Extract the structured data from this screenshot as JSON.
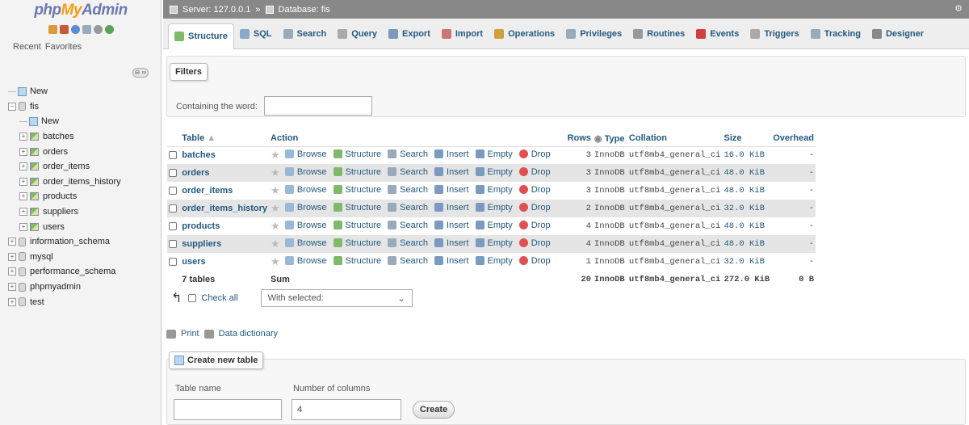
{
  "nav": {
    "logo_php": "php",
    "logo_my": "My",
    "logo_admin": "Admin",
    "tabs": [
      "Recent",
      "Favorites"
    ],
    "collapse_label": "⊖ ∞",
    "tree": [
      {
        "label": "New",
        "kind": "new",
        "indent": 0
      },
      {
        "label": "fis",
        "kind": "db",
        "indent": 0,
        "expanded": true
      },
      {
        "label": "New",
        "kind": "new",
        "indent": 1
      },
      {
        "label": "batches",
        "kind": "table",
        "indent": 1
      },
      {
        "label": "orders",
        "kind": "table",
        "indent": 1
      },
      {
        "label": "order_items",
        "kind": "table",
        "indent": 1
      },
      {
        "label": "order_items_history",
        "kind": "table",
        "indent": 1
      },
      {
        "label": "products",
        "kind": "table",
        "indent": 1
      },
      {
        "label": "suppliers",
        "kind": "table",
        "indent": 1
      },
      {
        "label": "users",
        "kind": "table",
        "indent": 1
      },
      {
        "label": "information_schema",
        "kind": "db",
        "indent": 0
      },
      {
        "label": "mysql",
        "kind": "db",
        "indent": 0
      },
      {
        "label": "performance_schema",
        "kind": "db",
        "indent": 0
      },
      {
        "label": "phpmyadmin",
        "kind": "db",
        "indent": 0
      },
      {
        "label": "test",
        "kind": "db",
        "indent": 0
      }
    ]
  },
  "topbar": {
    "server": "Server: 127.0.0.1",
    "sep": "»",
    "database": "Database: fis"
  },
  "tabs": [
    {
      "label": "Structure",
      "icon": "structure-icon",
      "color": "#7fb96a",
      "active": true
    },
    {
      "label": "SQL",
      "icon": "sql-icon",
      "color": "#8aa8c8"
    },
    {
      "label": "Search",
      "icon": "search-icon",
      "color": "#9ab"
    },
    {
      "label": "Query",
      "icon": "query-icon",
      "color": "#aaa"
    },
    {
      "label": "Export",
      "icon": "export-icon",
      "color": "#7a9ac0"
    },
    {
      "label": "Import",
      "icon": "import-icon",
      "color": "#c77"
    },
    {
      "label": "Operations",
      "icon": "operations-icon",
      "color": "#d0a040"
    },
    {
      "label": "Privileges",
      "icon": "privileges-icon",
      "color": "#9ab"
    },
    {
      "label": "Routines",
      "icon": "routines-icon",
      "color": "#999"
    },
    {
      "label": "Events",
      "icon": "events-icon",
      "color": "#d04040"
    },
    {
      "label": "Triggers",
      "icon": "triggers-icon",
      "color": "#aaa"
    },
    {
      "label": "Tracking",
      "icon": "tracking-icon",
      "color": "#9ab"
    },
    {
      "label": "Designer",
      "icon": "designer-icon",
      "color": "#888"
    }
  ],
  "filters": {
    "legend": "Filters",
    "label": "Containing the word:",
    "value": ""
  },
  "table": {
    "headers": {
      "table": "Table",
      "action": "Action",
      "rows": "Rows",
      "type": "Type",
      "collation": "Collation",
      "size": "Size",
      "overhead": "Overhead"
    },
    "actions": [
      "Browse",
      "Structure",
      "Search",
      "Insert",
      "Empty",
      "Drop"
    ],
    "rows": [
      {
        "name": "batches",
        "rows": "3",
        "type": "InnoDB",
        "collation": "utf8mb4_general_ci",
        "size": "16.0 KiB",
        "overhead": "-"
      },
      {
        "name": "orders",
        "rows": "3",
        "type": "InnoDB",
        "collation": "utf8mb4_general_ci",
        "size": "48.0 KiB",
        "overhead": "-"
      },
      {
        "name": "order_items",
        "rows": "3",
        "type": "InnoDB",
        "collation": "utf8mb4_general_ci",
        "size": "48.0 KiB",
        "overhead": "-"
      },
      {
        "name": "order_items_history",
        "rows": "2",
        "type": "InnoDB",
        "collation": "utf8mb4_general_ci",
        "size": "32.0 KiB",
        "overhead": "-"
      },
      {
        "name": "products",
        "rows": "4",
        "type": "InnoDB",
        "collation": "utf8mb4_general_ci",
        "size": "48.0 KiB",
        "overhead": "-"
      },
      {
        "name": "suppliers",
        "rows": "4",
        "type": "InnoDB",
        "collation": "utf8mb4_general_ci",
        "size": "48.0 KiB",
        "overhead": "-"
      },
      {
        "name": "users",
        "rows": "1",
        "type": "InnoDB",
        "collation": "utf8mb4_general_ci",
        "size": "32.0 KiB",
        "overhead": "-"
      }
    ],
    "footer": {
      "count": "7 tables",
      "action": "Sum",
      "rows": "20",
      "type": "InnoDB",
      "collation": "utf8mb4_general_ci",
      "size": "272.0 KiB",
      "overhead": "0 B"
    }
  },
  "bulk": {
    "check_all": "Check all",
    "with_selected": "With selected:"
  },
  "links": {
    "print": "Print",
    "data_dictionary": "Data dictionary"
  },
  "create": {
    "legend": "Create new table",
    "table_name_label": "Table name",
    "columns_label": "Number of columns",
    "columns_value": "4",
    "button": "Create"
  }
}
